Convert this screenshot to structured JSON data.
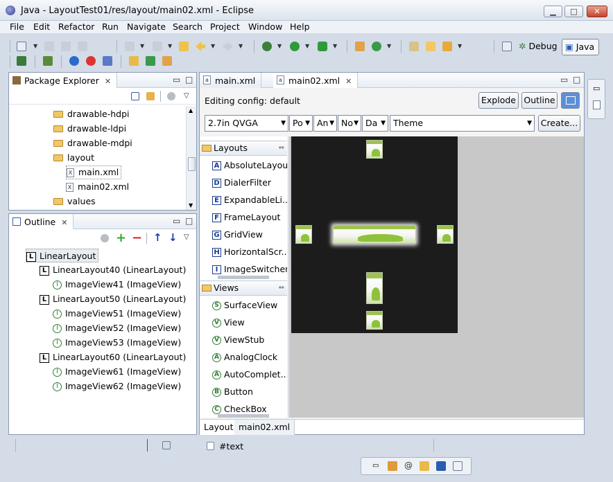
{
  "window": {
    "title": "Java - LayoutTest01/res/layout/main02.xml - Eclipse",
    "min": "▁",
    "max": "□",
    "close": "✕"
  },
  "menu": [
    "File",
    "Edit",
    "Refactor",
    "Run",
    "Navigate",
    "Search",
    "Project",
    "Window",
    "Help"
  ],
  "perspectives": {
    "debug": "Debug",
    "java": "Java"
  },
  "package_explorer": {
    "title": "Package Explorer",
    "items": [
      {
        "label": "drawable-hdpi",
        "type": "folder"
      },
      {
        "label": "drawable-ldpi",
        "type": "folder"
      },
      {
        "label": "drawable-mdpi",
        "type": "folder"
      },
      {
        "label": "layout",
        "type": "folder"
      },
      {
        "label": "main.xml",
        "type": "xml"
      },
      {
        "label": "main02.xml",
        "type": "xml"
      },
      {
        "label": "values",
        "type": "folder"
      }
    ]
  },
  "outline": {
    "title": "Outline",
    "items": [
      {
        "label": "LinearLayout",
        "icon": "L",
        "level": 0
      },
      {
        "label": "LinearLayout40 (LinearLayout)",
        "icon": "L",
        "level": 1
      },
      {
        "label": "ImageView41 (ImageView)",
        "icon": "I",
        "level": 2
      },
      {
        "label": "LinearLayout50 (LinearLayout)",
        "icon": "L",
        "level": 1
      },
      {
        "label": "ImageView51 (ImageView)",
        "icon": "I",
        "level": 2
      },
      {
        "label": "ImageView52 (ImageView)",
        "icon": "I",
        "level": 2
      },
      {
        "label": "ImageView53 (ImageView)",
        "icon": "I",
        "level": 2
      },
      {
        "label": "LinearLayout60 (LinearLayout)",
        "icon": "L",
        "level": 1
      },
      {
        "label": "ImageView61 (ImageView)",
        "icon": "I",
        "level": 2
      },
      {
        "label": "ImageView62 (ImageView)",
        "icon": "I",
        "level": 2
      }
    ]
  },
  "editor": {
    "tabs": [
      {
        "label": "main.xml"
      },
      {
        "label": "main02.xml",
        "active": true
      }
    ],
    "config_label": "Editing config:",
    "config_value": "default",
    "explode": "Explode",
    "outline": "Outline",
    "device": "2.7in QVGA",
    "combo_po": "Po",
    "combo_an": "An",
    "combo_no": "No",
    "combo_da": "Da",
    "theme": "Theme",
    "create": "Create...",
    "bottom_tabs": [
      "Layout",
      "main02.xml"
    ]
  },
  "palette": {
    "layouts_header": "Layouts",
    "layouts": [
      {
        "icon": "A",
        "label": "AbsoluteLayout"
      },
      {
        "icon": "D",
        "label": "DialerFilter"
      },
      {
        "icon": "E",
        "label": "ExpandableLi..."
      },
      {
        "icon": "F",
        "label": "FrameLayout"
      },
      {
        "icon": "G",
        "label": "GridView"
      },
      {
        "icon": "H",
        "label": "HorizontalScr..."
      },
      {
        "icon": "I",
        "label": "ImageSwitcher"
      }
    ],
    "views_header": "Views",
    "views": [
      {
        "icon": "S",
        "label": "SurfaceView"
      },
      {
        "icon": "V",
        "label": "View"
      },
      {
        "icon": "V",
        "label": "ViewStub"
      },
      {
        "icon": "A",
        "label": "AnalogClock"
      },
      {
        "icon": "A",
        "label": "AutoComplet..."
      },
      {
        "icon": "B",
        "label": "Button"
      },
      {
        "icon": "C",
        "label": "CheckBox"
      }
    ]
  },
  "status": {
    "text": "#text"
  }
}
